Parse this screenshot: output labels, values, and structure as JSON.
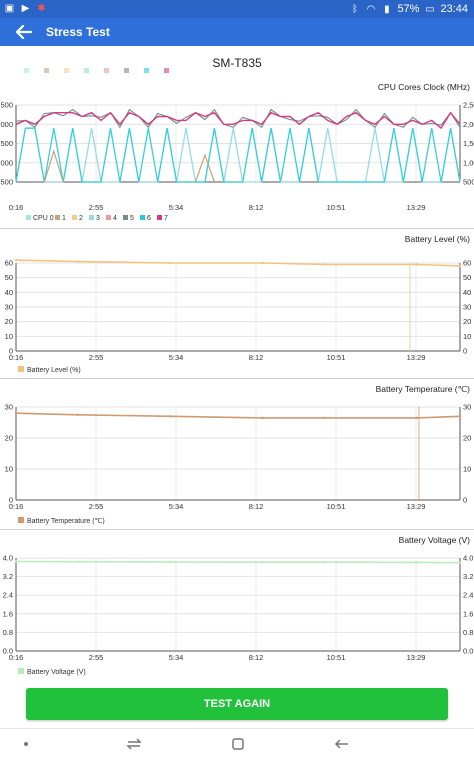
{
  "status_bar": {
    "battery": "57%",
    "time": "23:44",
    "left_icons": [
      "image-notification-icon",
      "cast-icon",
      "bug-icon"
    ],
    "right_icons": [
      "bluetooth-icon",
      "wifi-icon",
      "signal-icon",
      "battery-icon"
    ]
  },
  "app_bar": {
    "title": "Stress Test"
  },
  "device": {
    "name": "SM-T835"
  },
  "x_ticks": [
    "0:16",
    "2:55",
    "5:34",
    "8:12",
    "10:51",
    "13:29"
  ],
  "chart_data": [
    {
      "type": "line",
      "title": "CPU Cores Clock (MHz)",
      "legend": [
        "CPU 0",
        "1",
        "2",
        "3",
        "4",
        "5",
        "6",
        "7"
      ],
      "colors": [
        "#a5e6e3",
        "#c8a27a",
        "#f7c98f",
        "#94d9e6",
        "#f19a9a",
        "#6e8f8a",
        "#22cdd8",
        "#d53a84"
      ],
      "yticks": [
        "500",
        "1,000",
        "1,500",
        "2,000",
        "2,500"
      ],
      "ylim": [
        500,
        2500
      ],
      "top_cluster": [
        2000,
        2100,
        2000,
        2200,
        2300,
        2300,
        2300,
        2200,
        2300,
        2100,
        2300,
        2000,
        2300,
        2200,
        2000,
        2200,
        2200,
        2100,
        2100,
        2300,
        2200,
        2300,
        2000,
        2000,
        2100,
        2100,
        2000,
        2300,
        2200,
        2200,
        2000,
        2200,
        2300,
        2100,
        2000,
        2200,
        2300,
        2100,
        2000,
        2200,
        2000,
        2000,
        2100,
        2000,
        2100,
        1900,
        2300,
        2000
      ],
      "low_cluster": [
        500,
        1900,
        1900,
        500,
        1900,
        500,
        1900,
        500,
        1900,
        500,
        1900,
        500,
        1900,
        500,
        1900,
        500,
        1900,
        500,
        1900,
        500,
        500,
        1900,
        500,
        1900,
        500,
        1900,
        500,
        1900,
        500,
        1900,
        500,
        1900,
        500,
        1900,
        500,
        500,
        500,
        500,
        1900,
        500,
        1900,
        500,
        1900,
        500,
        1900,
        500,
        1900,
        500
      ]
    },
    {
      "type": "line",
      "title": "Battery Level (%)",
      "legend": [
        "Battery Level (%)"
      ],
      "color": "#f5c27c",
      "yticks": [
        "0",
        "10",
        "20",
        "30",
        "40",
        "50",
        "60"
      ],
      "ylim": [
        0,
        60
      ],
      "x_minutes": [
        0,
        2,
        5,
        8,
        10,
        13,
        14.4
      ],
      "values": [
        62,
        61,
        60,
        60,
        59,
        59,
        58
      ]
    },
    {
      "type": "line",
      "title": "Battery Temperature (℃)",
      "legend": [
        "Battery Temperature (℃)"
      ],
      "color": "#cf9a6f",
      "yticks": [
        "0",
        "10",
        "20",
        "30"
      ],
      "ylim": [
        0,
        30
      ],
      "x_minutes": [
        0,
        2,
        5,
        8,
        10,
        13,
        14.4
      ],
      "values": [
        28,
        27.5,
        27,
        26.5,
        26.5,
        26.5,
        27
      ]
    },
    {
      "type": "line",
      "title": "Battery Voltage (V)",
      "legend": [
        "Battery Voltage (V)"
      ],
      "color": "#b9ecb9",
      "yticks": [
        "0.0",
        "0.8",
        "1.6",
        "2.4",
        "3.2",
        "4.0"
      ],
      "ylim": [
        0,
        4.0
      ],
      "x_minutes": [
        0,
        2,
        5,
        8,
        10,
        13,
        14.4
      ],
      "values": [
        3.85,
        3.84,
        3.83,
        3.82,
        3.82,
        3.81,
        3.8
      ]
    }
  ],
  "button": {
    "label": "TEST AGAIN"
  },
  "nav": {
    "items": [
      "recent-dot-icon",
      "recents-icon",
      "home-icon",
      "back-nav-icon"
    ]
  }
}
